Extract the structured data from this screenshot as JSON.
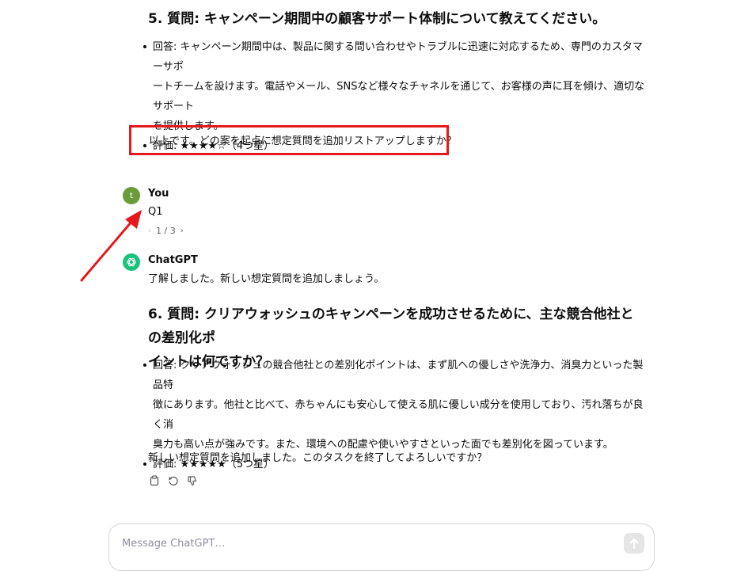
{
  "section5": {
    "heading": "5. 質問: キャンペーン期間中の顧客サポート体制について教えてください。",
    "answer_line1": "回答: キャンペーン期間中は、製品に関する問い合わせやトラブルに迅速に対応するため、専門のカスタマーサポ",
    "answer_line2": "ートチームを設けます。電話やメール、SNSなど様々なチャネルを通じて、お客様の声に耳を傾け、適切なサポート",
    "answer_line3": "を提供します。",
    "rating": "評価: ★★★★☆（4つ星）",
    "rating_stars": 4
  },
  "highlighted_text": "以上です。どの案を起点に想定質問を追加リストアップしますか？",
  "user_message": {
    "avatar_letter": "t",
    "author": "You",
    "text": "Q1",
    "pager": {
      "prev": "‹",
      "label": "1 / 3",
      "next": "›"
    }
  },
  "assistant_message": {
    "author": "ChatGPT",
    "intro": "了解しました。新しい想定質問を追加しましょう。"
  },
  "section6": {
    "heading_line1": "6. 質問: クリアウォッシュのキャンペーンを成功させるために、主な競合他社との差別化ポ",
    "heading_line2": "イントは何ですか？",
    "answer_line1": "回答: クリアウォッシュの競合他社との差別化ポイントは、まず肌への優しさや洗浄力、消臭力といった製品特",
    "answer_line2": "徴にあります。他社と比べて、赤ちゃんにも安心して使える肌に優しい成分を使用しており、汚れ落ちが良く消",
    "answer_line3": "臭力も高い点が強みです。また、環境への配慮や使いやすさといった面でも差別化を図っています。",
    "rating": "評価: ★★★★★（5つ星）",
    "rating_stars": 5
  },
  "closing_text": "新しい想定質問を追加しました。このタスクを終了してよろしいですか？",
  "composer": {
    "placeholder": "Message ChatGPT…"
  },
  "colors": {
    "highlight_border": "#e5191b",
    "arrow": "#e5191b",
    "user_avatar": "#6a9a3a",
    "assistant_avatar": "#19c37d"
  },
  "icons": [
    "copy-icon",
    "regenerate-icon",
    "thumbs-down-icon",
    "arrow-up-icon",
    "openai-logo-icon"
  ]
}
